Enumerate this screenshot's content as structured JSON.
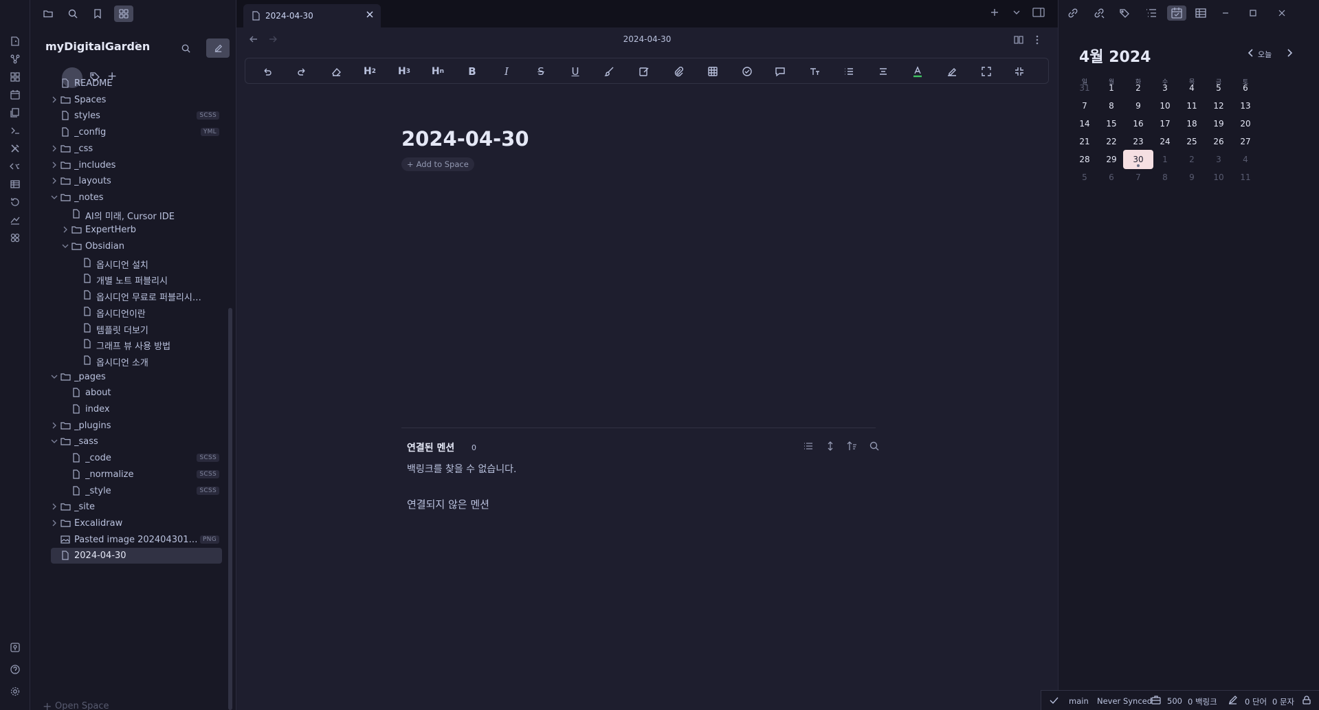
{
  "sidebar": {
    "vault_name": "myDigitalGarden",
    "open_space": "Open Space",
    "tree": [
      {
        "label": "README",
        "type": "file",
        "depth": 0
      },
      {
        "label": "Spaces",
        "type": "folder",
        "depth": 0,
        "expanded": false
      },
      {
        "label": "styles",
        "type": "file",
        "depth": 0,
        "badge": "SCSS"
      },
      {
        "label": "_config",
        "type": "file",
        "depth": 0,
        "badge": "YML"
      },
      {
        "label": "_css",
        "type": "folder",
        "depth": 0,
        "expanded": false
      },
      {
        "label": "_includes",
        "type": "folder",
        "depth": 0,
        "expanded": false
      },
      {
        "label": "_layouts",
        "type": "folder",
        "depth": 0,
        "expanded": false
      },
      {
        "label": "_notes",
        "type": "folder",
        "depth": 0,
        "expanded": true
      },
      {
        "label": "AI의 미래, Cursor IDE",
        "type": "file",
        "depth": 1
      },
      {
        "label": "ExpertHerb",
        "type": "folder",
        "depth": 1,
        "expanded": false
      },
      {
        "label": "Obsidian",
        "type": "folder",
        "depth": 1,
        "expanded": true
      },
      {
        "label": "옵시디언 설치",
        "type": "file",
        "depth": 2
      },
      {
        "label": "개별 노트 퍼블리시",
        "type": "file",
        "depth": 2
      },
      {
        "label": "옵시디언 무료로 퍼블리시하...",
        "type": "file",
        "depth": 2
      },
      {
        "label": "옵시디언이란",
        "type": "file",
        "depth": 2
      },
      {
        "label": "템플릿 더보기",
        "type": "file",
        "depth": 2
      },
      {
        "label": "그래프 뷰 사용 방법",
        "type": "file",
        "depth": 2
      },
      {
        "label": "옵시디언 소개",
        "type": "file",
        "depth": 2
      },
      {
        "label": "_pages",
        "type": "folder",
        "depth": 0,
        "expanded": true
      },
      {
        "label": "about",
        "type": "file",
        "depth": 1
      },
      {
        "label": "index",
        "type": "file",
        "depth": 1
      },
      {
        "label": "_plugins",
        "type": "folder",
        "depth": 0,
        "expanded": false
      },
      {
        "label": "_sass",
        "type": "folder",
        "depth": 0,
        "expanded": true
      },
      {
        "label": "_code",
        "type": "file",
        "depth": 1,
        "badge": "SCSS"
      },
      {
        "label": "_normalize",
        "type": "file",
        "depth": 1,
        "badge": "SCSS"
      },
      {
        "label": "_style",
        "type": "file",
        "depth": 1,
        "badge": "SCSS"
      },
      {
        "label": "_site",
        "type": "folder",
        "depth": 0,
        "expanded": false
      },
      {
        "label": "Excalidraw",
        "type": "folder",
        "depth": 0,
        "expanded": false
      },
      {
        "label": "Pasted image 202404301049...",
        "type": "image",
        "depth": 0,
        "badge": "PNG"
      },
      {
        "label": "2024-04-30",
        "type": "file",
        "depth": 0,
        "selected": true
      }
    ]
  },
  "tab": {
    "label": "2024-04-30"
  },
  "editor": {
    "breadcrumb_title": "2024-04-30",
    "title": "2024-04-30",
    "add_to_space": "Add to Space",
    "toolbar": [
      "undo-icon",
      "redo-icon",
      "eraser-icon",
      "H2",
      "H3",
      "Hn",
      "B",
      "I",
      "S",
      "U",
      "brush-icon",
      "edit-icon",
      "attach-icon",
      "table-icon",
      "check-icon",
      "comment-icon",
      "text-size-icon",
      "list-icon",
      "align-icon",
      "font-color-icon",
      "highlight-icon",
      "expand-icon",
      "collapse-icon"
    ]
  },
  "mentions": {
    "linked_title": "연결된 멘션",
    "linked_count": "0",
    "no_backlinks": "백링크를 찾을 수 없습니다.",
    "unlinked_title": "연결되지 않은 멘션"
  },
  "calendar": {
    "title": "4월 2024",
    "today_label": "오늘",
    "weekdays": [
      "일",
      "월",
      "화",
      "수",
      "목",
      "금",
      "토"
    ],
    "weeks": [
      [
        "31",
        "1",
        "2",
        "3",
        "4",
        "5",
        "6"
      ],
      [
        "7",
        "8",
        "9",
        "10",
        "11",
        "12",
        "13"
      ],
      [
        "14",
        "15",
        "16",
        "17",
        "18",
        "19",
        "20"
      ],
      [
        "21",
        "22",
        "23",
        "24",
        "25",
        "26",
        "27"
      ],
      [
        "28",
        "29",
        "30",
        "1",
        "2",
        "3",
        "4"
      ],
      [
        "5",
        "6",
        "7",
        "8",
        "9",
        "10",
        "11"
      ]
    ],
    "selected_day": "30"
  },
  "status": {
    "branch": "main",
    "sync": "Never Synced",
    "value": "500",
    "backlinks": "0 백링크",
    "words": "0 단어",
    "chars": "0 문자"
  },
  "colors": {
    "accent": "#f5dfe2",
    "bg": "#1e1e2e",
    "panel": "#181825"
  }
}
